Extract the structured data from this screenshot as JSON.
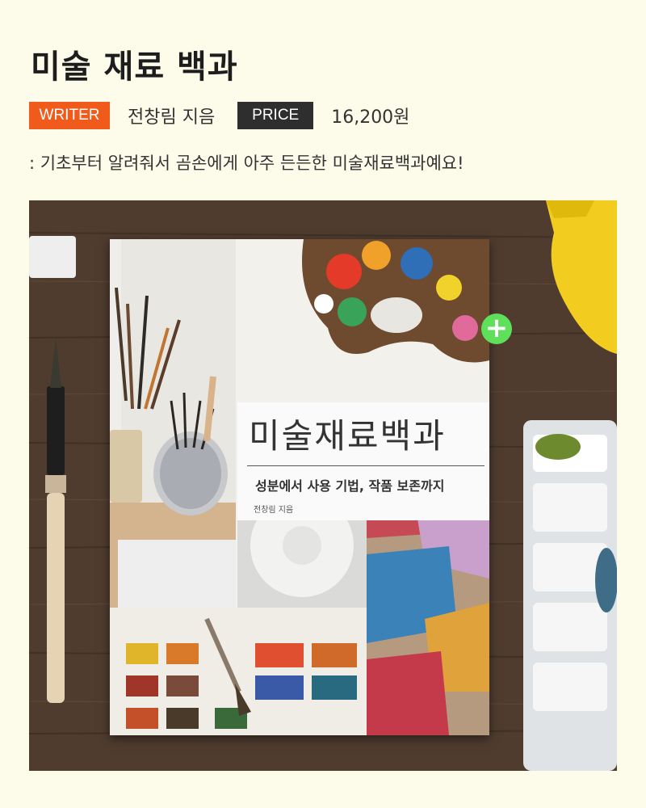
{
  "title": "미술 재료 백과",
  "writer": {
    "label": "WRITER",
    "value": "전창림 지음"
  },
  "price": {
    "label": "PRICE",
    "value": "16,200원"
  },
  "description": ": 기초부터 알려줘서 곰손에게 아주 든든한 미술재료백과예요!",
  "book": {
    "cover_title": "미술재료백과",
    "cover_subtitle": "성분에서 사용 기법, 작품 보존까지",
    "cover_author": "전창림 지음"
  },
  "plus_icon": "plus-icon",
  "colors": {
    "writer_tag": "#f05a1a",
    "price_tag": "#2e2e2e",
    "plus": "#5ee05a",
    "background": "#fdfbe9"
  }
}
